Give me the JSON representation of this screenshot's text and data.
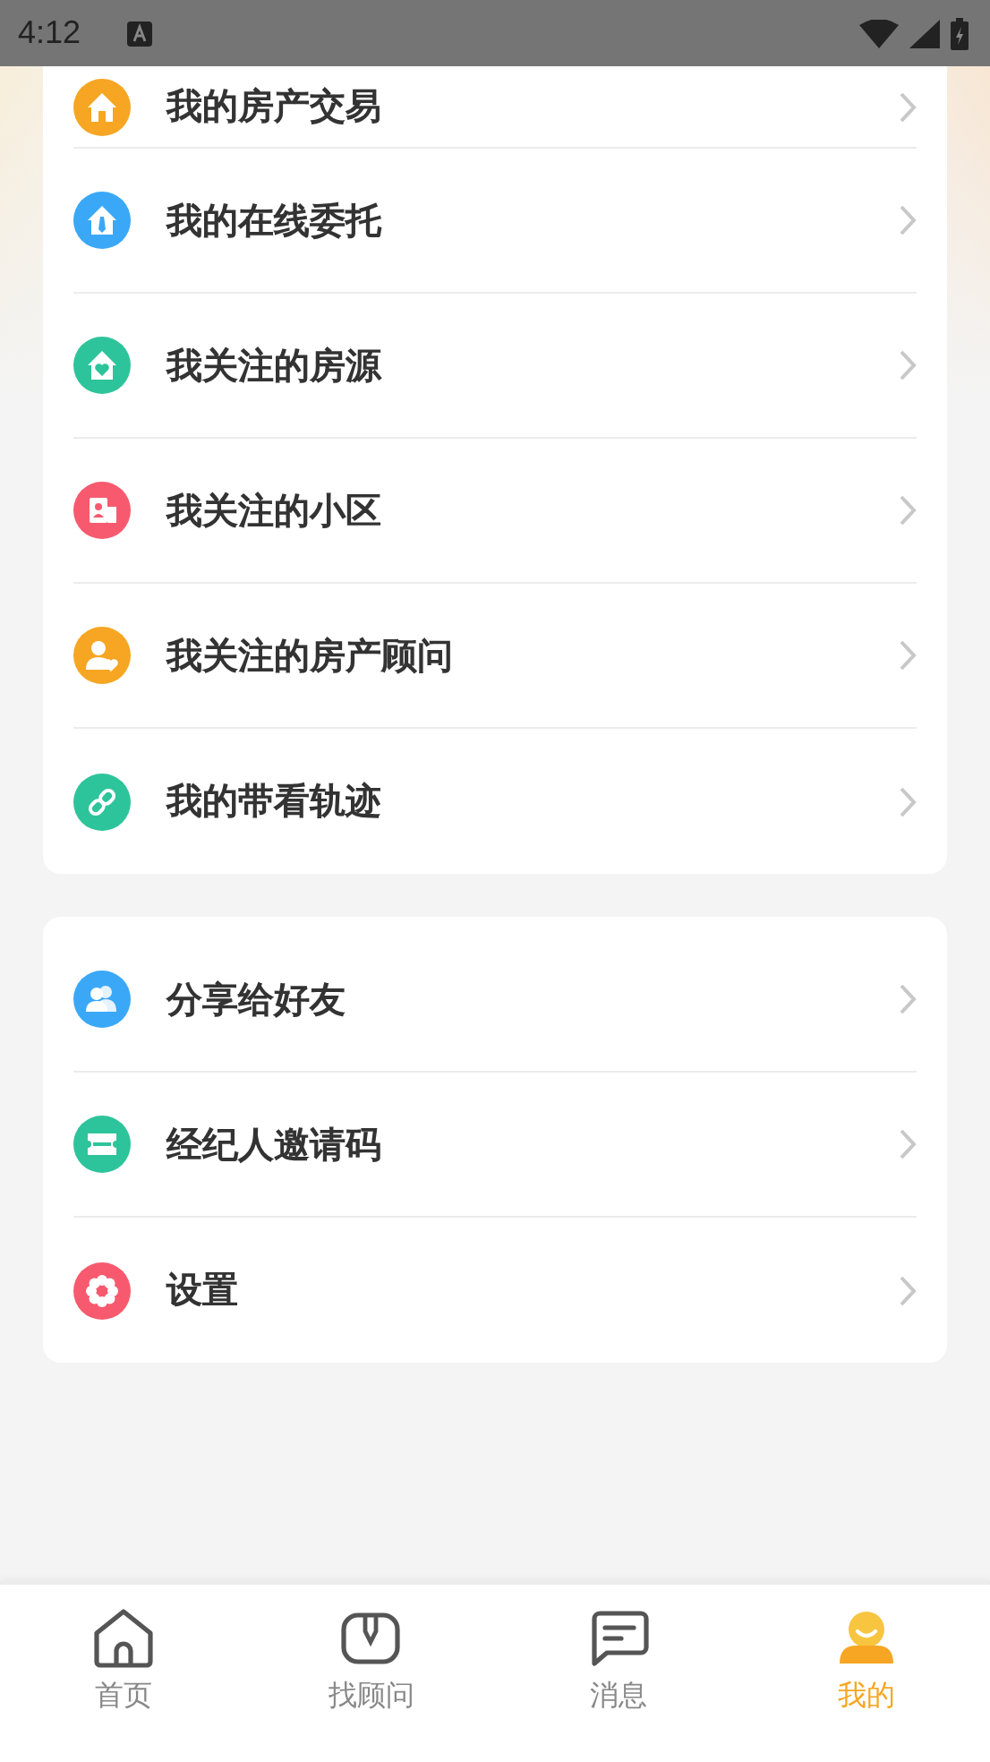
{
  "status_bar": {
    "time": "4:12"
  },
  "menu_groups": [
    {
      "items": [
        {
          "label": "我的房产交易",
          "kind": "house",
          "color": "#f6a623"
        },
        {
          "label": "我的在线委托",
          "kind": "tie-house",
          "color": "#3aa8f7"
        },
        {
          "label": "我关注的房源",
          "kind": "heart-house",
          "color": "#2ec49b"
        },
        {
          "label": "我关注的小区",
          "kind": "building",
          "color": "#f75a6e"
        },
        {
          "label": "我关注的房产顾问",
          "kind": "person-heart",
          "color": "#f6a623"
        },
        {
          "label": "我的带看轨迹",
          "kind": "link",
          "color": "#2ec49b"
        }
      ]
    },
    {
      "items": [
        {
          "label": "分享给好友",
          "kind": "people",
          "color": "#3aa8f7"
        },
        {
          "label": "经纪人邀请码",
          "kind": "ticket",
          "color": "#2ec49b"
        },
        {
          "label": "设置",
          "kind": "gear",
          "color": "#f75a6e"
        }
      ]
    }
  ],
  "tab_bar": [
    {
      "label": "首页",
      "kind": "home",
      "selected": false
    },
    {
      "label": "找顾问",
      "kind": "advisor",
      "selected": false
    },
    {
      "label": "消息",
      "kind": "message",
      "selected": false
    },
    {
      "label": "我的",
      "kind": "profile",
      "selected": true
    }
  ]
}
